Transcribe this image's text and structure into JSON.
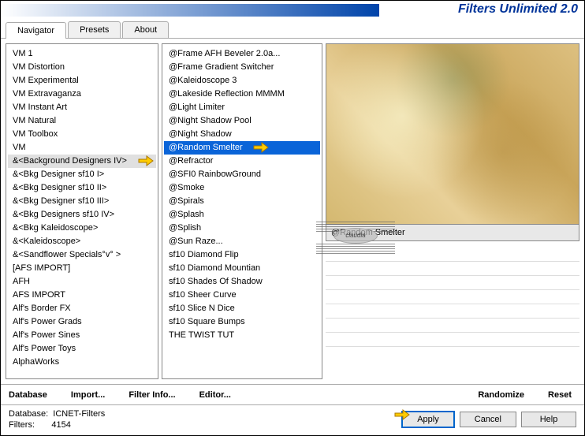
{
  "title": "Filters Unlimited 2.0",
  "tabs": {
    "navigator": "Navigator",
    "presets": "Presets",
    "about": "About"
  },
  "categories": [
    "VM 1",
    "VM Distortion",
    "VM Experimental",
    "VM Extravaganza",
    "VM Instant Art",
    "VM Natural",
    "VM Toolbox",
    "VM",
    "&<Background Designers IV>",
    "&<Bkg Designer sf10 I>",
    "&<Bkg Designer sf10 II>",
    "&<Bkg Designer sf10 III>",
    "&<Bkg Designers sf10 IV>",
    "&<Bkg Kaleidoscope>",
    "&<Kaleidoscope>",
    "&<Sandflower Specials°v° >",
    "[AFS IMPORT]",
    "AFH",
    "AFS IMPORT",
    "Alf's Border FX",
    "Alf's Power Grads",
    "Alf's Power Sines",
    "Alf's Power Toys",
    "AlphaWorks"
  ],
  "selected_category_index": 8,
  "filters": [
    "@Frame AFH Beveler 2.0a...",
    "@Frame Gradient Switcher",
    "@Kaleidoscope 3",
    "@Lakeside Reflection MMMM",
    "@Light Limiter",
    "@Night Shadow Pool",
    "@Night Shadow",
    "@Random Smelter",
    "@Refractor",
    "@SFI0 RainbowGround",
    "@Smoke",
    "@Spirals",
    "@Splash",
    "@Splish",
    "@Sun Raze...",
    "sf10 Diamond Flip",
    "sf10 Diamond Mountian",
    "sf10 Shades Of Shadow",
    "sf10 Sheer Curve",
    "sf10 Slice N Dice",
    "sf10 Square Bumps",
    "THE TWIST TUT"
  ],
  "selected_filter_index": 7,
  "selected_filter_name": "@Random Smelter",
  "buttons": {
    "database": "Database",
    "import": "Import...",
    "filter_info": "Filter Info...",
    "editor": "Editor...",
    "randomize": "Randomize",
    "reset": "Reset",
    "apply": "Apply",
    "cancel": "Cancel",
    "help": "Help"
  },
  "status": {
    "db_label": "Database:",
    "db_value": "ICNET-Filters",
    "filters_label": "Filters:",
    "filters_value": "4154"
  },
  "watermark": "claudia"
}
